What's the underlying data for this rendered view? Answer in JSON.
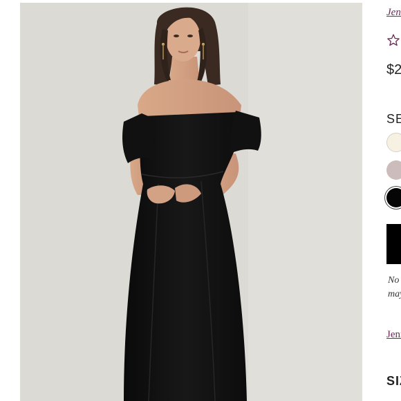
{
  "product": {
    "brand_link": "Jenn",
    "rating_count": "",
    "price": "$2",
    "note_line_1": "No",
    "note_line_2": "may",
    "brand_link_2": "Jenn"
  },
  "color_section": {
    "heading": "SE",
    "swatches": [
      {
        "name": "ivory",
        "color": "#f6f1e3"
      },
      {
        "name": "mauve",
        "color": "#cdbcbc"
      },
      {
        "name": "black",
        "color": "#050505",
        "selected": true
      }
    ]
  },
  "size_section": {
    "heading": "SIZ"
  },
  "photo": {
    "background_color": "#dcdad5",
    "dress_color": "#111111"
  },
  "icons": {
    "rating": "star-outline-icon"
  }
}
